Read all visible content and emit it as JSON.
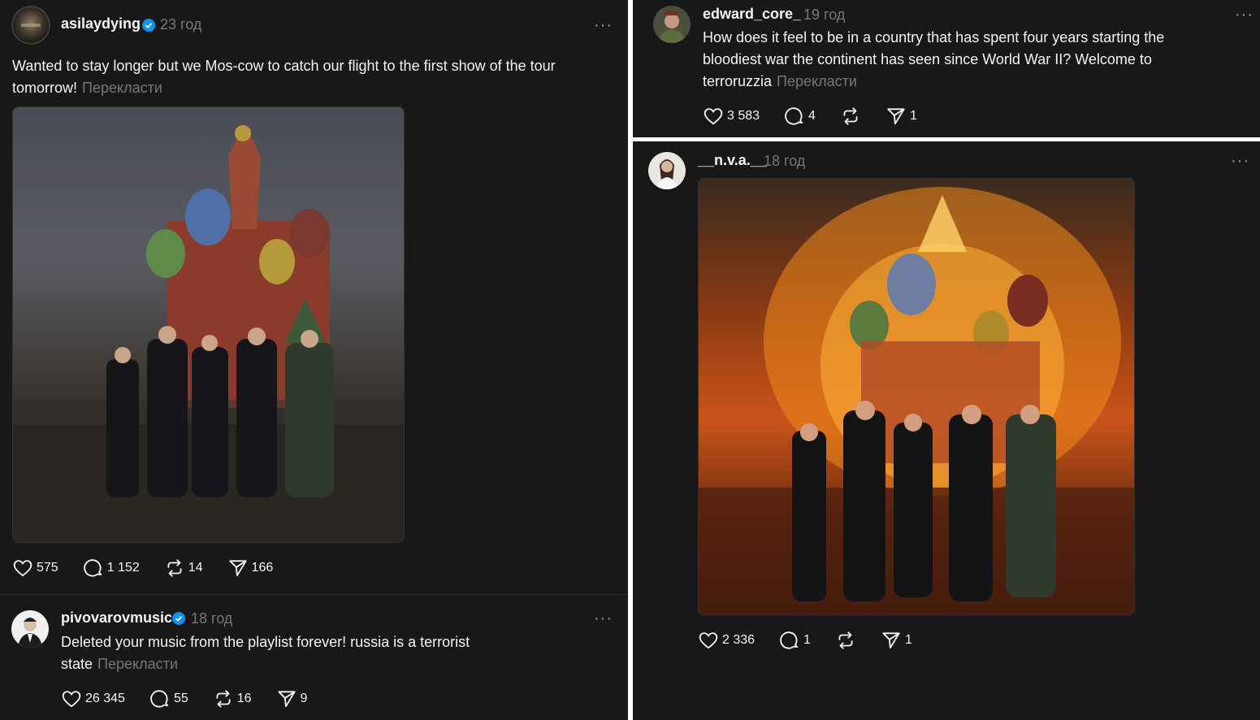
{
  "posts": [
    {
      "username": "asilaydying",
      "time": "23 год",
      "text": "Wanted to stay longer but we Mos-cow to catch our flight to the first show of the tour tomorrow!",
      "translate": "Перекласти",
      "likes": "575",
      "comments": "1 152",
      "reposts": "14",
      "shares": "166"
    },
    {
      "username": "pivovarovmusic",
      "time": "18 год",
      "text": "Deleted your music from the playlist forever! russia is a terrorist state",
      "translate": "Перекласти",
      "likes": "26 345",
      "comments": "55",
      "reposts": "16",
      "shares": "9"
    },
    {
      "username": "edward_core_",
      "time": "19 год",
      "text": "How does it feel to be in a country that has spent four years starting the bloodiest war the continent has seen since World War II? Welcome to terroruzzia",
      "translate": "Перекласти",
      "likes": "3 583",
      "comments": "4",
      "reposts": "",
      "shares": "1"
    },
    {
      "username": "__n.v.a.__",
      "time": "18 год",
      "likes": "2 336",
      "comments": "1",
      "reposts": "",
      "shares": "1"
    }
  ],
  "icons": {
    "verified": "verified-badge-icon",
    "like": "heart-icon",
    "comment": "comment-bubble-icon",
    "repost": "repost-icon",
    "share": "send-icon",
    "more": "more-options-icon"
  },
  "colors": {
    "background": "#181818",
    "verified": "#0095f6",
    "muted": "#777777"
  }
}
